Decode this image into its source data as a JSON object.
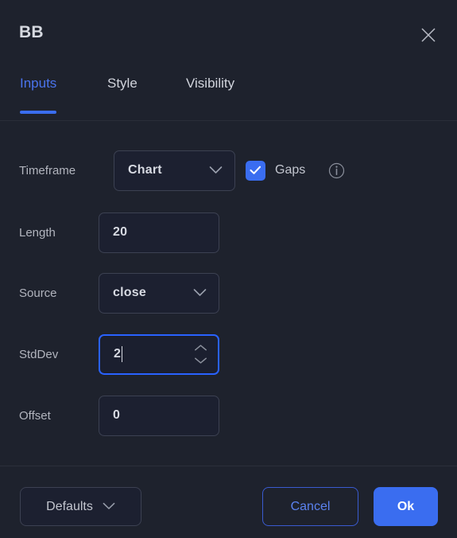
{
  "dialog": {
    "title": "BB",
    "close_icon": "close-icon"
  },
  "tabs": [
    {
      "label": "Inputs",
      "active": true
    },
    {
      "label": "Style",
      "active": false
    },
    {
      "label": "Visibility",
      "active": false
    }
  ],
  "inputs": {
    "timeframe": {
      "label": "Timeframe",
      "value": "Chart",
      "chevron_icon": "chevron-down-icon"
    },
    "gaps": {
      "label": "Gaps",
      "checked": true,
      "check_icon": "check-icon",
      "info_icon": "info-icon"
    },
    "length": {
      "label": "Length",
      "value": "20"
    },
    "source": {
      "label": "Source",
      "value": "close",
      "chevron_icon": "chevron-down-icon"
    },
    "stddev": {
      "label": "StdDev",
      "value": "2",
      "focused": true,
      "stepper_up_icon": "chevron-up-icon",
      "stepper_down_icon": "chevron-down-icon"
    },
    "offset": {
      "label": "Offset",
      "value": "0"
    }
  },
  "footer": {
    "defaults_label": "Defaults",
    "defaults_chevron_icon": "chevron-down-icon",
    "cancel_label": "Cancel",
    "ok_label": "Ok"
  },
  "colors": {
    "background": "#1e222d",
    "accent_blue": "#3a6df0",
    "focus_blue": "#2962ff",
    "text_primary": "#d1d4dc",
    "text_secondary": "#b2b5be",
    "border": "#3c4152",
    "divider": "#2a2e39"
  }
}
